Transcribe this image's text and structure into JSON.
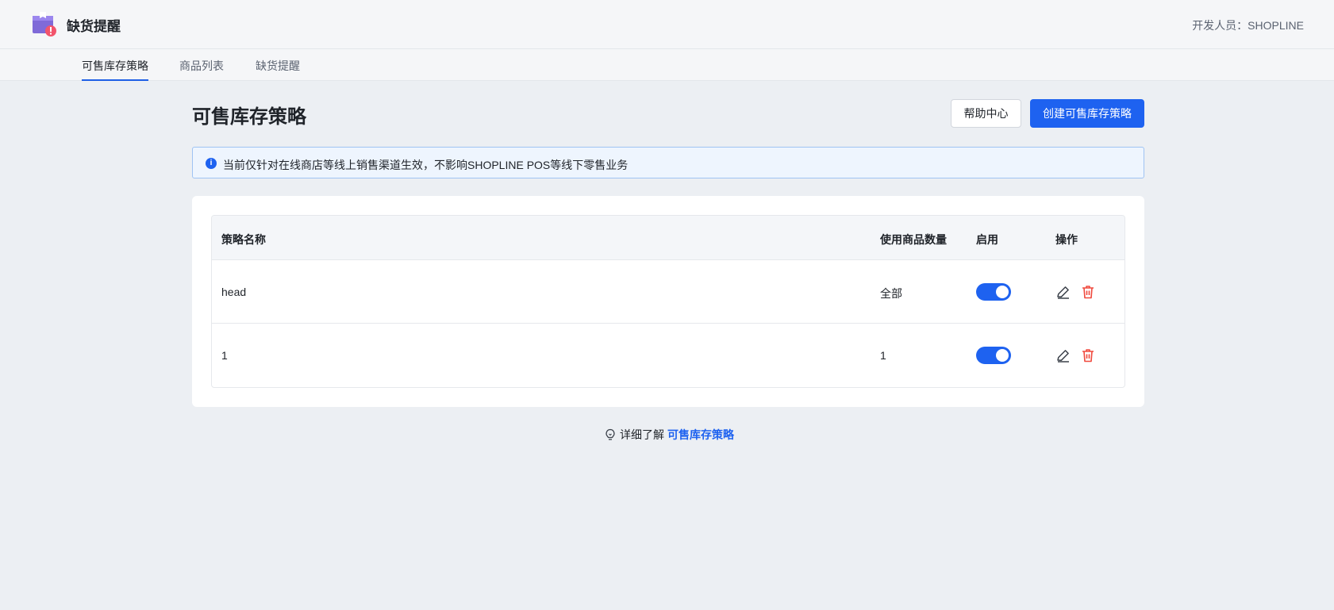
{
  "header": {
    "app_title": "缺货提醒",
    "developer": "开发人员：SHOPLINE",
    "logo_icon": "package-alert-icon"
  },
  "tabs": [
    {
      "label": "可售库存策略",
      "active": true
    },
    {
      "label": "商品列表",
      "active": false
    },
    {
      "label": "缺货提醒",
      "active": false
    }
  ],
  "page": {
    "title": "可售库存策略",
    "help_button": "帮助中心",
    "create_button": "创建可售库存策略"
  },
  "notice": {
    "icon": "info-icon",
    "text": "当前仅针对在线商店等线上销售渠道生效，不影响SHOPLINE POS等线下零售业务"
  },
  "table": {
    "columns": [
      "策略名称",
      "使用商品数量",
      "启用",
      "操作"
    ],
    "rows": [
      {
        "name": "head",
        "count": "全部",
        "enabled": true
      },
      {
        "name": "1",
        "count": "1",
        "enabled": true
      }
    ]
  },
  "footer": {
    "prefix": "详细了解",
    "link": "可售库存策略"
  },
  "colors": {
    "accent": "#1e62f0",
    "danger": "#f04a3e",
    "background": "#eceff3"
  }
}
